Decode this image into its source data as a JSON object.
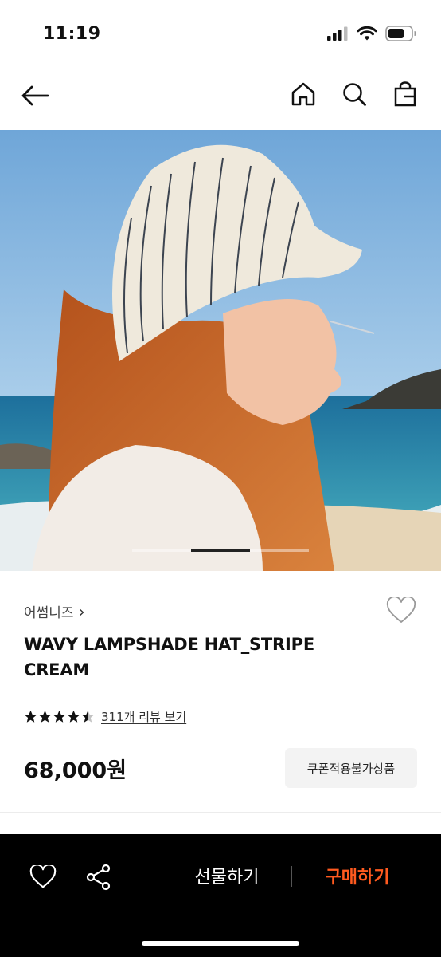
{
  "status_bar": {
    "time": "11:19",
    "icons": [
      "cellular-signal-icon",
      "wifi-icon",
      "battery-icon"
    ]
  },
  "nav": {
    "icons": [
      "back-arrow-icon",
      "home-icon",
      "search-icon",
      "shopping-bag-icon"
    ]
  },
  "gallery": {
    "image_description": "product-photo",
    "page_count": 3,
    "active_index": 1
  },
  "product": {
    "brand": "어썸니즈",
    "brand_chevron": "›",
    "title": "WAVY LAMPSHADE HAT_STRIPE CREAM",
    "rating": 4.5,
    "review_link": "311개 리뷰 보기",
    "price": "68,000원",
    "coupon_badge": "쿠폰적용불가상품"
  },
  "bottom_bar": {
    "gift_label": "선물하기",
    "buy_label": "구매하기",
    "buy_color": "#ff5a1f"
  }
}
